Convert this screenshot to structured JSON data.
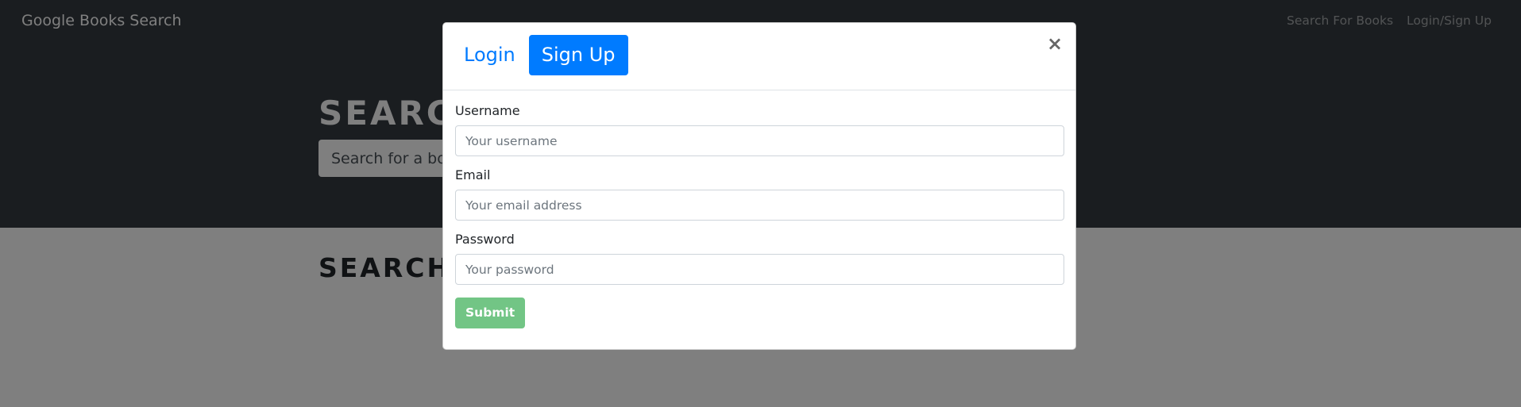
{
  "navbar": {
    "brand": "Google Books Search",
    "links": [
      "Search For Books",
      "Login/Sign Up"
    ]
  },
  "hero": {
    "title": "SEARCH FOR BOOKS!",
    "search_placeholder": "Search for a book"
  },
  "results": {
    "title": "SEARCH FOR A BOOK TO BEGIN"
  },
  "modal": {
    "tabs": [
      {
        "label": "Login",
        "active": false
      },
      {
        "label": "Sign Up",
        "active": true
      }
    ],
    "close_label": "×",
    "fields": {
      "username": {
        "label": "Username",
        "placeholder": "Your username",
        "value": ""
      },
      "email": {
        "label": "Email",
        "placeholder": "Your email address",
        "value": ""
      },
      "password": {
        "label": "Password",
        "placeholder": "Your password",
        "value": ""
      }
    },
    "submit_label": "Submit"
  },
  "colors": {
    "navbar_bg": "#343a40",
    "primary": "#007bff",
    "success": "#28a745",
    "backdrop": "rgba(0,0,0,0.5)"
  },
  "icons": {
    "close": "close-icon"
  }
}
